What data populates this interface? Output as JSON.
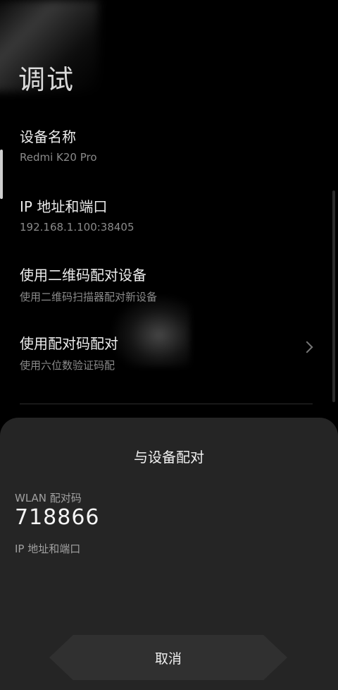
{
  "header": {
    "title_fragment": "调试"
  },
  "list": {
    "device_name": {
      "title": "设备名称",
      "subtitle": "Redmi K20 Pro"
    },
    "ip_port": {
      "title": "IP 地址和端口",
      "subtitle": "192.168.1.100:38405"
    },
    "qr_pair": {
      "title": "使用二维码配对设备",
      "subtitle": "使用二维码扫描器配对新设备"
    },
    "code_pair": {
      "title": "使用配对码配对",
      "subtitle": "使用六位数验证码配"
    }
  },
  "dialog": {
    "title": "与设备配对",
    "wlan_code_label": "WLAN 配对码",
    "wlan_code": "718866",
    "ip_label": "IP 地址和端口",
    "cancel_label": "取消"
  },
  "colors": {
    "background": "#000000",
    "sheet": "#252525",
    "button": "#303030"
  },
  "icons": {
    "code_pair_chevron": "chevron-right-icon"
  }
}
